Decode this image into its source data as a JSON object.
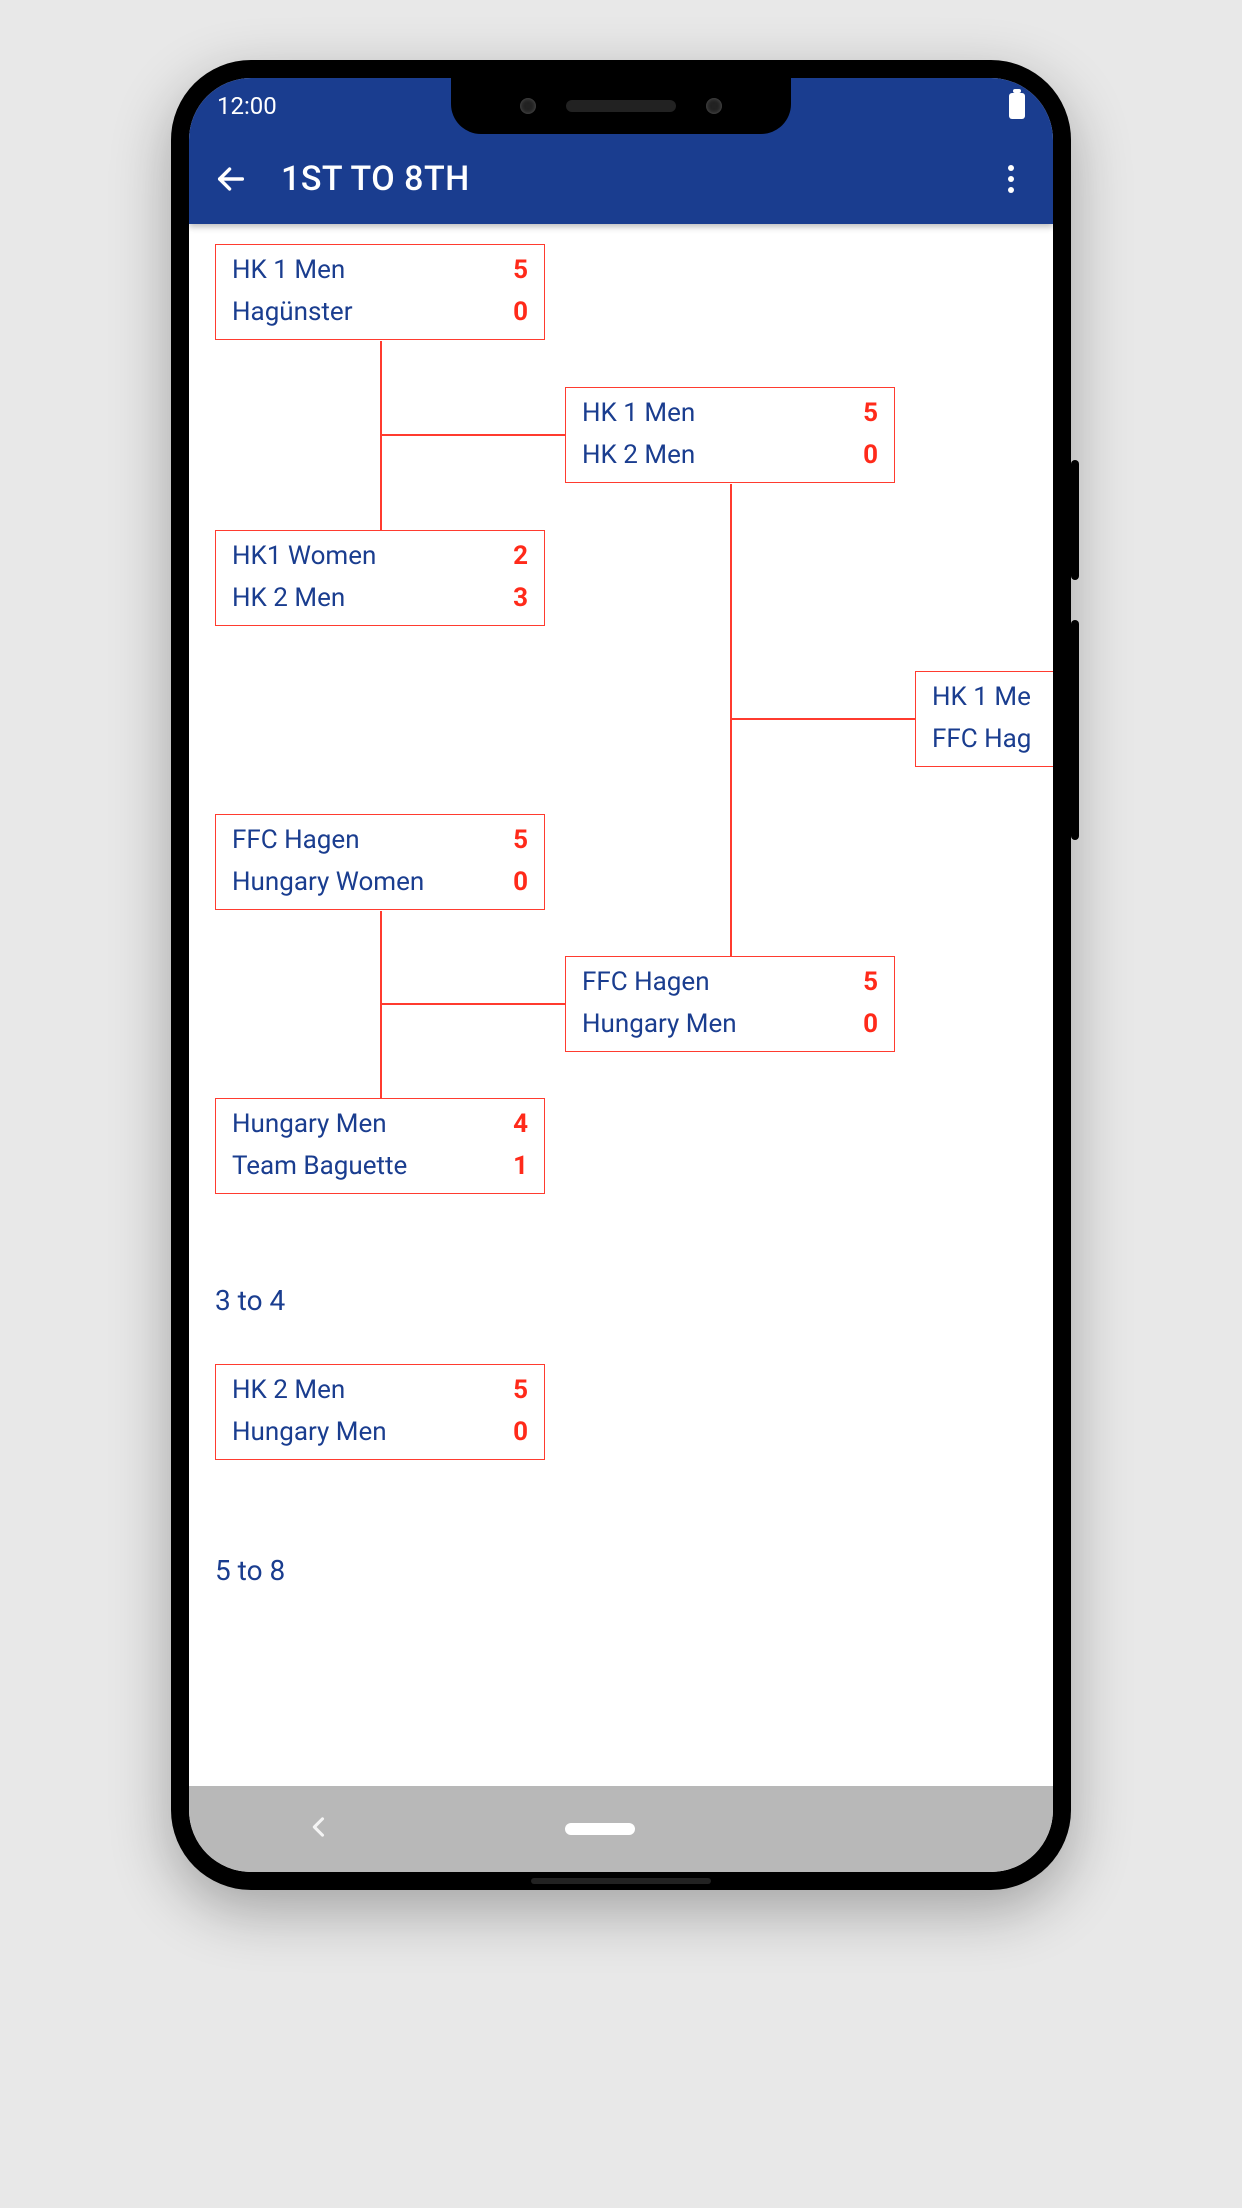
{
  "status": {
    "time": "12:00"
  },
  "appbar": {
    "title": "1ST TO 8TH"
  },
  "bracket": {
    "qf1": {
      "t1": "HK 1 Men",
      "s1": "5",
      "t2": "Hagünster",
      "s2": "0"
    },
    "qf2": {
      "t1": "HK1 Women",
      "s1": "2",
      "t2": "HK 2 Men",
      "s2": "3"
    },
    "qf3": {
      "t1": "FFC Hagen",
      "s1": "5",
      "t2": "Hungary Women",
      "s2": "0"
    },
    "qf4": {
      "t1": "Hungary Men",
      "s1": "4",
      "t2": "Team Baguette",
      "s2": "1"
    },
    "sf1": {
      "t1": "HK 1 Men",
      "s1": "5",
      "t2": "HK 2 Men",
      "s2": "0"
    },
    "sf2": {
      "t1": "FFC Hagen",
      "s1": "5",
      "t2": "Hungary Men",
      "s2": "0"
    },
    "final": {
      "t1": "HK 1 Me",
      "t2": "FFC Hag"
    },
    "third": {
      "t1": "HK 2 Men",
      "s1": "5",
      "t2": "Hungary Men",
      "s2": "0"
    }
  },
  "labels": {
    "third": "3 to 4",
    "fifth": "5 to 8"
  }
}
